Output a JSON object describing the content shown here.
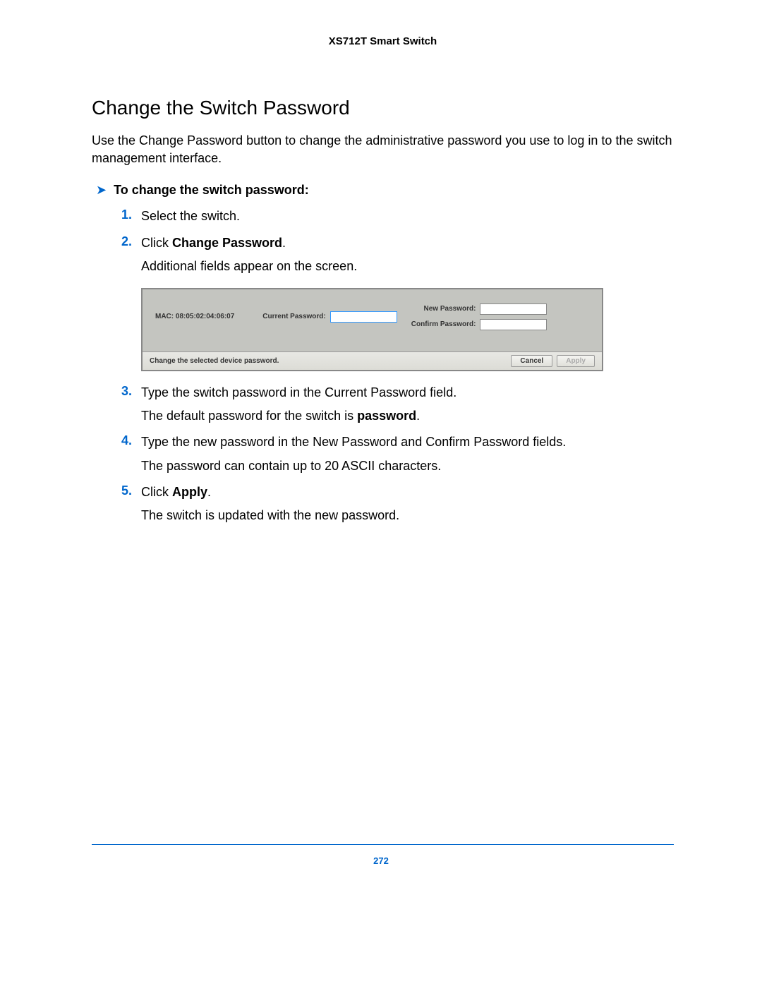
{
  "header": {
    "product": "XS712T Smart Switch"
  },
  "section": {
    "title": "Change the Switch Password",
    "intro": "Use the Change Password button to change the administrative password you use to log in to the switch management interface."
  },
  "procedure": {
    "heading": "To change the switch password:",
    "steps": [
      {
        "num": "1.",
        "text": "Select the switch."
      },
      {
        "num": "2.",
        "prefix": "Click ",
        "bold": "Change Password",
        "suffix": ".",
        "sub": "Additional fields appear on the screen."
      },
      {
        "num": "3.",
        "text": "Type the switch password in the Current Password field.",
        "sub_prefix": "The default password for the switch is ",
        "sub_bold": "password",
        "sub_suffix": "."
      },
      {
        "num": "4.",
        "text": "Type the new password in the New Password and Confirm Password fields.",
        "sub": "The password can contain up to 20 ASCII characters."
      },
      {
        "num": "5.",
        "prefix": "Click ",
        "bold": "Apply",
        "suffix": ".",
        "sub": "The switch is updated with the new password."
      }
    ]
  },
  "dialog": {
    "mac": "MAC: 08:05:02:04:06:07",
    "current_pw_label": "Current Password:",
    "new_pw_label": "New Password:",
    "confirm_pw_label": "Confirm Password:",
    "footer_text": "Change the selected device password.",
    "cancel": "Cancel",
    "apply": "Apply"
  },
  "footer": {
    "page_number": "272"
  }
}
